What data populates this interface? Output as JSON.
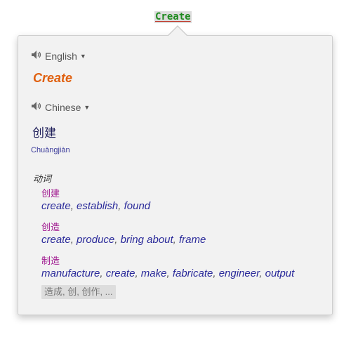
{
  "selection": {
    "word": "Create"
  },
  "source": {
    "language": "English",
    "word": "Create"
  },
  "target": {
    "language": "Chinese",
    "word": "创建",
    "pinyin": "Chuàngjiàn"
  },
  "dictionary": {
    "part_of_speech": "动词",
    "entries": [
      {
        "word": "创建",
        "glosses": [
          "create",
          "establish",
          "found"
        ]
      },
      {
        "word": "创造",
        "glosses": [
          "create",
          "produce",
          "bring about",
          "frame"
        ]
      },
      {
        "word": "制造",
        "glosses": [
          "manufacture",
          "create",
          "make",
          "fabricate",
          "engineer",
          "output"
        ]
      }
    ],
    "more": "造成, 创, 创作, ..."
  },
  "icons": {
    "speaker": "speaker-icon",
    "caret": "caret-down-icon"
  },
  "colors": {
    "source_word": "#e0600f",
    "entry_word": "#a0188f",
    "gloss": "#2a2a9a",
    "selection_text": "#1f8a1f"
  }
}
